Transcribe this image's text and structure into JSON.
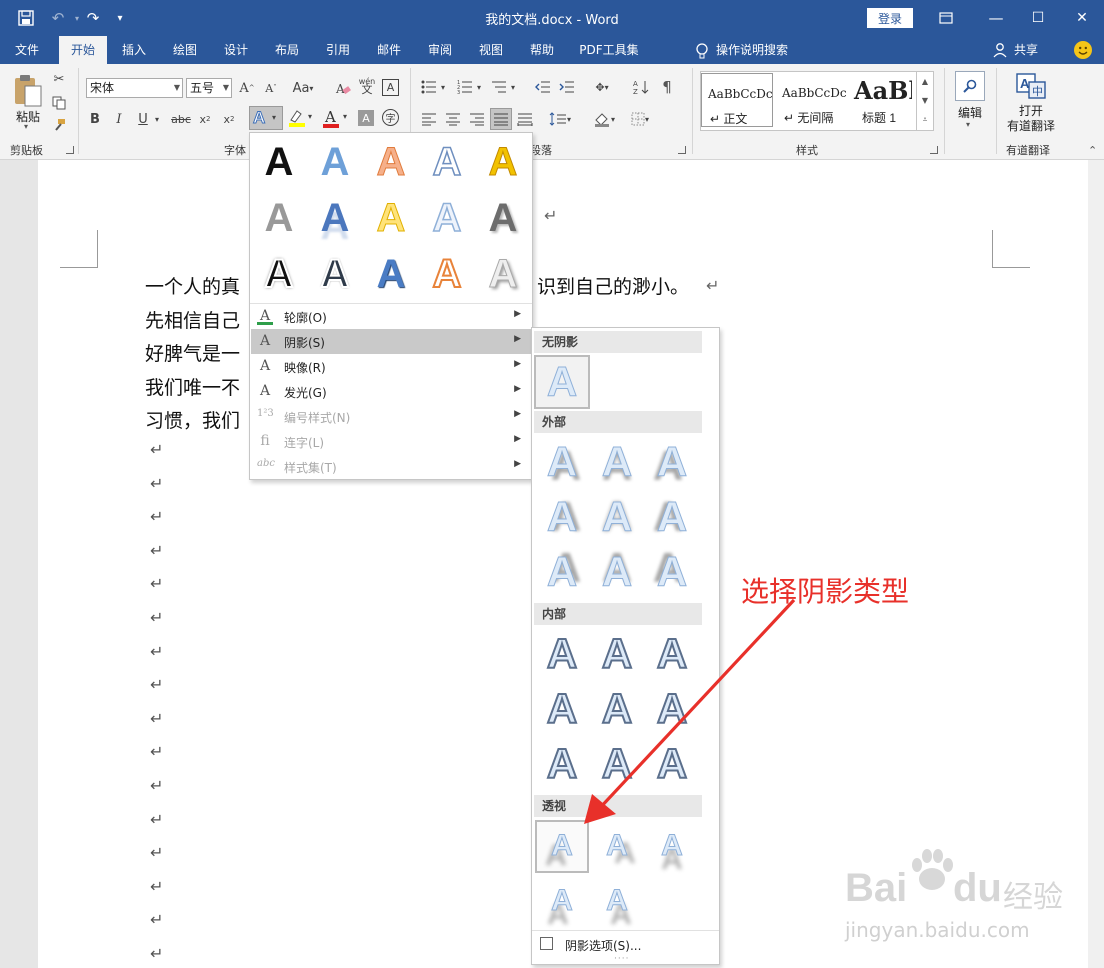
{
  "titlebar": {
    "title": "我的文档.docx  -  Word",
    "login": "登录",
    "minimize": "—",
    "maximize": "☐",
    "close": "✕"
  },
  "tabs": [
    {
      "label": "文件"
    },
    {
      "label": "开始"
    },
    {
      "label": "插入"
    },
    {
      "label": "绘图"
    },
    {
      "label": "设计"
    },
    {
      "label": "布局"
    },
    {
      "label": "引用"
    },
    {
      "label": "邮件"
    },
    {
      "label": "审阅"
    },
    {
      "label": "视图"
    },
    {
      "label": "帮助"
    },
    {
      "label": "PDF工具集"
    }
  ],
  "tell_me": "操作说明搜索",
  "share": "共享",
  "ribbon": {
    "clipboard": {
      "paste": "粘贴",
      "group": "剪贴板"
    },
    "font": {
      "name": "宋体",
      "size": "五号",
      "group": "字体",
      "change_case": "Aa",
      "pinyin": "wén"
    },
    "paragraph_group": "段落",
    "styles": {
      "group": "样式",
      "items": [
        {
          "preview": "AaBbCcDc",
          "name": "↵ 正文"
        },
        {
          "preview": "AaBbCcDc",
          "name": "↵ 无间隔"
        },
        {
          "preview": "AaBl",
          "name": "标题 1"
        }
      ]
    },
    "editing": {
      "label": "编辑"
    },
    "youdao": {
      "line1": "打开",
      "line2": "有道翻译",
      "group": "有道翻译"
    }
  },
  "document": {
    "lines": [
      "一个人的真",
      "先相信自己",
      "好脾气是一",
      "我们唯一不",
      "习惯，我们"
    ],
    "line1_tail": "识到自己的渺小。",
    "paragraph_mark": "↵"
  },
  "effects_menu": {
    "items": [
      {
        "label": "轮廓(O)",
        "enabled": true
      },
      {
        "label": "阴影(S)",
        "enabled": true,
        "highlighted": true
      },
      {
        "label": "映像(R)",
        "enabled": true
      },
      {
        "label": "发光(G)",
        "enabled": true
      },
      {
        "label": "编号样式(N)",
        "enabled": false
      },
      {
        "label": "连字(L)",
        "enabled": false
      },
      {
        "label": "样式集(T)",
        "enabled": false
      }
    ]
  },
  "shadow_menu": {
    "sections": {
      "none": "无阴影",
      "outer": "外部",
      "inner": "内部",
      "perspective": "透视"
    },
    "options_label": "阴影选项(S)..."
  },
  "annotation": "选择阴影类型",
  "watermark": {
    "brand": "Bai",
    "brand2": "du",
    "cn": "经验",
    "url": "jingyan.baidu.com"
  },
  "colors": {
    "word_blue": "#2b579a",
    "annotation_red": "#e8302a"
  }
}
